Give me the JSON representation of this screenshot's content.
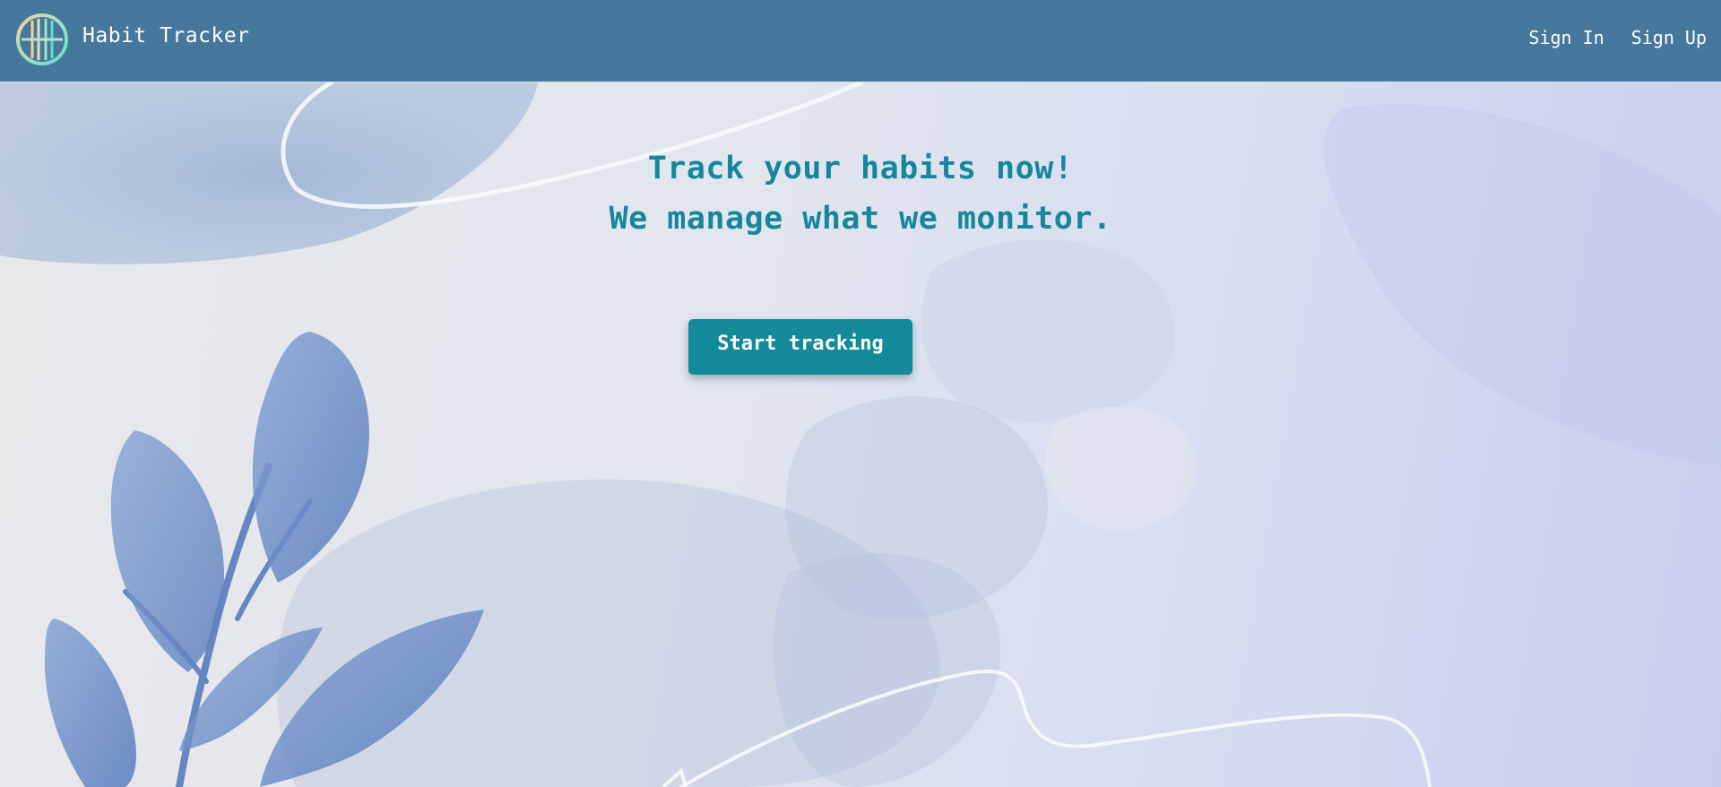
{
  "header": {
    "brand_name": "Habit Tracker",
    "logo_icon": "habit-tracker-logo-icon",
    "nav": {
      "sign_in": "Sign In",
      "sign_up": "Sign Up"
    }
  },
  "hero": {
    "headline": "Track your habits now!",
    "subheadline": "We manage what we monitor.",
    "cta_label": "Start tracking"
  },
  "colors": {
    "navbar": "#46779c",
    "accent": "#138a99",
    "headline": "#16879a",
    "nav_text": "#ffffff"
  }
}
